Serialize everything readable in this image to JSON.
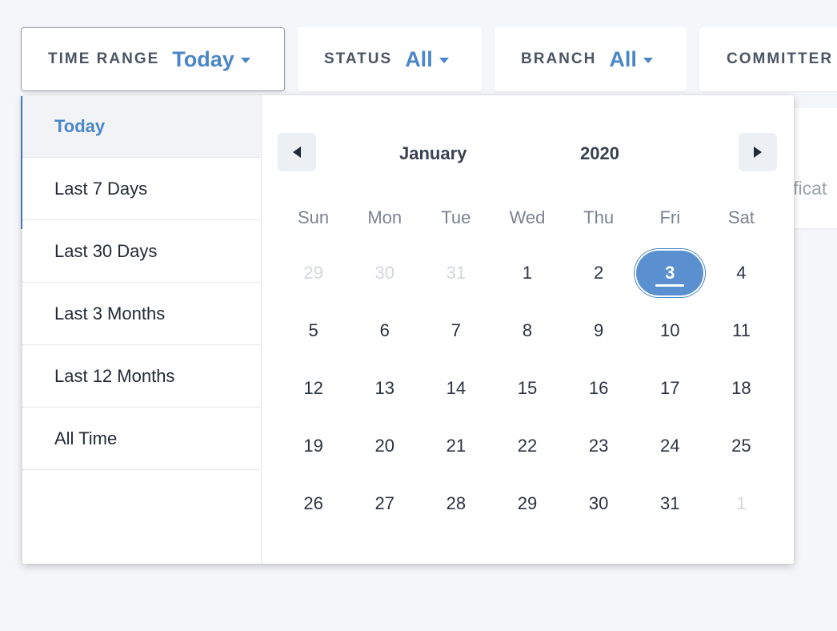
{
  "filters": {
    "time_range": {
      "label": "TIME RANGE",
      "value": "Today"
    },
    "status": {
      "label": "STATUS",
      "value": "All"
    },
    "branch": {
      "label": "BRANCH",
      "value": "All"
    },
    "committer": {
      "label": "COMMITTER"
    }
  },
  "background_card": {
    "partial_text": "ificat"
  },
  "presets": [
    "Today",
    "Last 7 Days",
    "Last 30 Days",
    "Last 3 Months",
    "Last 12 Months",
    "All Time"
  ],
  "selected_preset": "Today",
  "calendar": {
    "month": "January",
    "year": "2020",
    "weekdays": [
      "Sun",
      "Mon",
      "Tue",
      "Wed",
      "Thu",
      "Fri",
      "Sat"
    ],
    "weeks": [
      [
        {
          "d": "29",
          "muted": true
        },
        {
          "d": "30",
          "muted": true
        },
        {
          "d": "31",
          "muted": true
        },
        {
          "d": "1"
        },
        {
          "d": "2"
        },
        {
          "d": "3",
          "selected": true
        },
        {
          "d": "4"
        }
      ],
      [
        {
          "d": "5"
        },
        {
          "d": "6"
        },
        {
          "d": "7"
        },
        {
          "d": "8"
        },
        {
          "d": "9"
        },
        {
          "d": "10"
        },
        {
          "d": "11"
        }
      ],
      [
        {
          "d": "12"
        },
        {
          "d": "13"
        },
        {
          "d": "14"
        },
        {
          "d": "15"
        },
        {
          "d": "16"
        },
        {
          "d": "17"
        },
        {
          "d": "18"
        }
      ],
      [
        {
          "d": "19"
        },
        {
          "d": "20"
        },
        {
          "d": "21"
        },
        {
          "d": "22"
        },
        {
          "d": "23"
        },
        {
          "d": "24"
        },
        {
          "d": "25"
        }
      ],
      [
        {
          "d": "26"
        },
        {
          "d": "27"
        },
        {
          "d": "28"
        },
        {
          "d": "29"
        },
        {
          "d": "30"
        },
        {
          "d": "31"
        },
        {
          "d": "1",
          "muted": true
        }
      ]
    ]
  },
  "colors": {
    "accent": "#4a86c8",
    "selected_day_bg": "#5b90d0",
    "page_bg": "#f5f6f9"
  }
}
